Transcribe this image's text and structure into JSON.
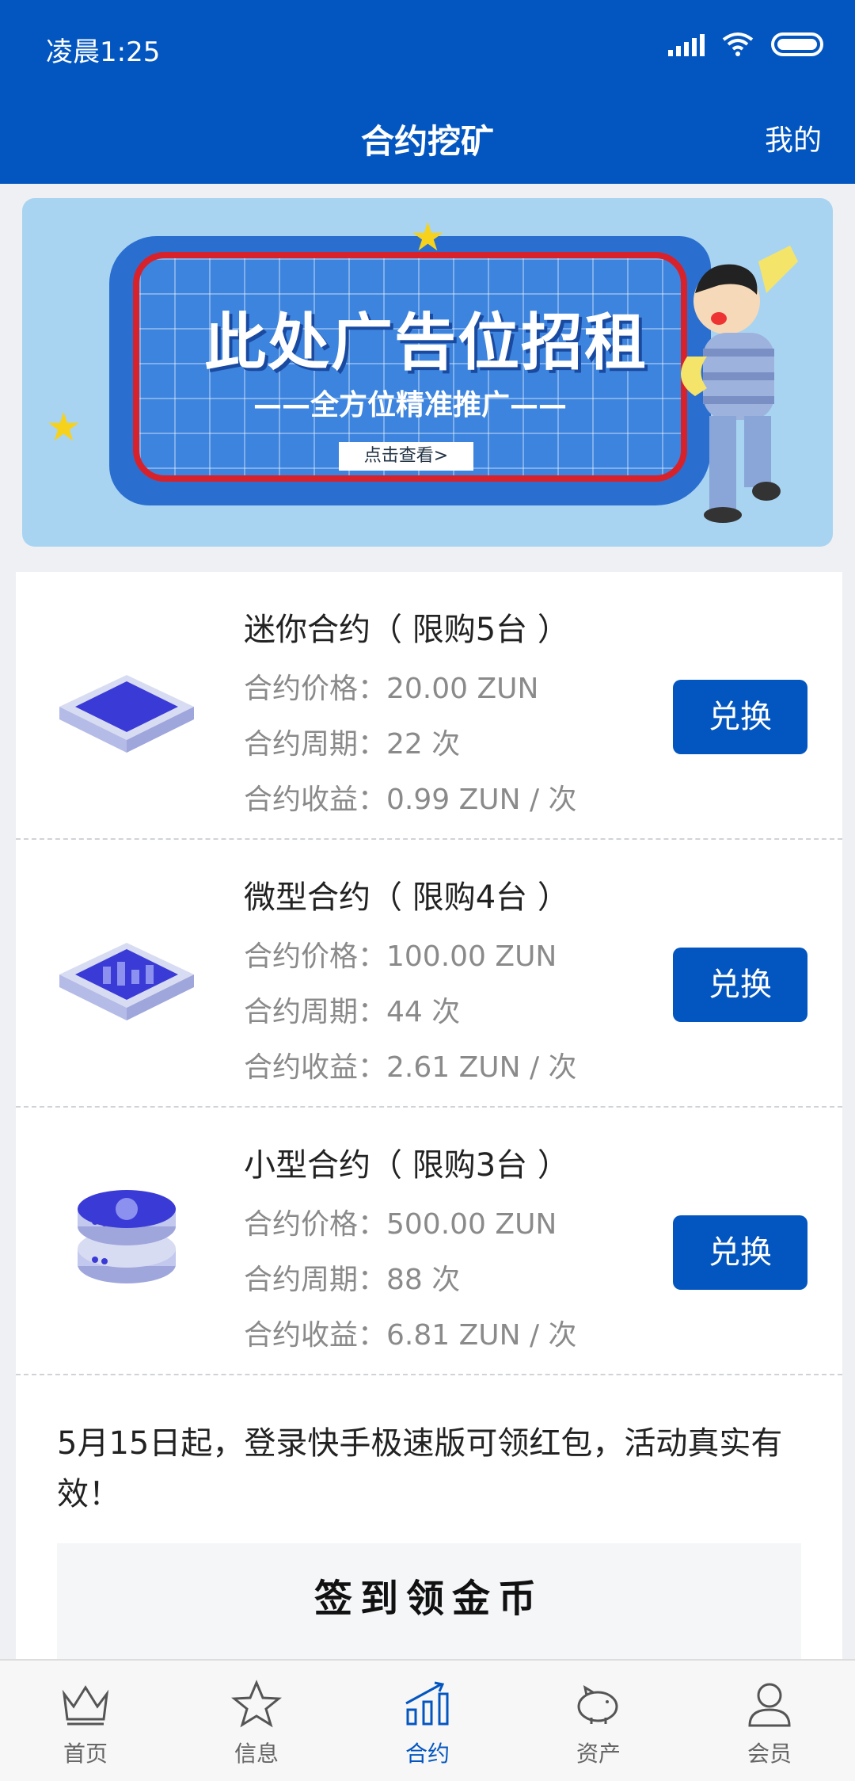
{
  "status_bar": {
    "time": "凌晨1:25"
  },
  "nav": {
    "title": "合约挖矿",
    "right_label": "我的"
  },
  "banner": {
    "headline": "此处广告位招租",
    "subline": "——全方位精准推广——",
    "button": "点击查看>"
  },
  "contracts": [
    {
      "title": "迷你合约（ 限购5台 ）",
      "price": "合约价格：20.00 ZUN",
      "period": "合约周期：22 次",
      "income": "合约收益：0.99 ZUN / 次",
      "button": "兑换",
      "icon": "mini-chip-icon"
    },
    {
      "title": "微型合约（ 限购4台 ）",
      "price": "合约价格：100.00 ZUN",
      "period": "合约周期：44 次",
      "income": "合约收益：2.61 ZUN / 次",
      "button": "兑换",
      "icon": "micro-chip-icon"
    },
    {
      "title": "小型合约（ 限购3台 ）",
      "price": "合约价格：500.00 ZUN",
      "period": "合约周期：88 次",
      "income": "合约收益：6.81 ZUN / 次",
      "button": "兑换",
      "icon": "small-server-icon"
    }
  ],
  "notice": "5月15日起，登录快手极速版可领红包，活动真实有效！",
  "signin_label": "签到领金币",
  "tabs": [
    {
      "label": "首页",
      "icon": "crown-icon"
    },
    {
      "label": "信息",
      "icon": "star-icon"
    },
    {
      "label": "合约",
      "icon": "chart-icon",
      "active": true
    },
    {
      "label": "资产",
      "icon": "piggy-bank-icon"
    },
    {
      "label": "会员",
      "icon": "user-icon"
    }
  ],
  "colors": {
    "brand": "#0356c0",
    "active_tab": "#0356c0"
  }
}
